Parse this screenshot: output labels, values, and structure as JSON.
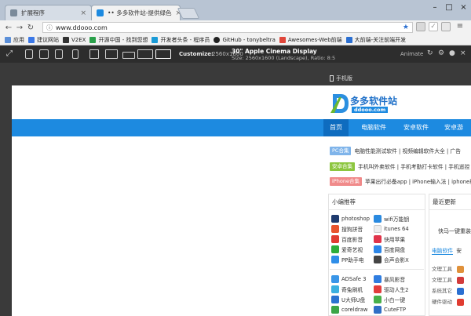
{
  "tabs": [
    {
      "title": "扩展程序",
      "active": false
    },
    {
      "title": "•• 多多软件站-提供绿色",
      "active": true
    }
  ],
  "address": {
    "url": "www.ddooo.com"
  },
  "bookmarks": [
    {
      "label": "应用",
      "color": "#5b8fd8"
    },
    {
      "label": "建议网站",
      "color": "#3b78e7"
    },
    {
      "label": "V2EX",
      "color": "#333333"
    },
    {
      "label": "开源中国 - 找到您想",
      "color": "#2aa04a"
    },
    {
      "label": "开发者头条 - 程序员",
      "color": "#1a9bd7"
    },
    {
      "label": "GitHub - tonybeltra",
      "color": "#222222"
    },
    {
      "label": "Awesomes-Web前端",
      "color": "#e0463a"
    },
    {
      "label": "大前端-关注前端开发",
      "color": "#2b6fd1"
    }
  ],
  "devtools": {
    "devices": [
      "10",
      "7",
      "5",
      "4",
      "lap",
      "13",
      "15",
      "27",
      "30"
    ],
    "customize_label": "Customize:",
    "customize_value": "2560x1600",
    "device_title": "30\" Apple Cinema Display",
    "device_info": "Size: 2560x1600 (Landscape), Ratio: 8:5",
    "animate_label": "Animate"
  },
  "page": {
    "mobile_label": "手机版",
    "logo_text": "多多软件站",
    "logo_sub": "ddooo.com",
    "nav": [
      "首页",
      "电脑软件",
      "安卓软件",
      "安卓游戏"
    ],
    "rows": [
      {
        "tag": "PC合集",
        "color": "#7fb4ea",
        "links": "电脑性能测试软件 | 视频编辑软件大全 | 广告"
      },
      {
        "tag": "安卓合集",
        "color": "#8cc63f",
        "links": "手机叫外卖软件 | 手机考勤打卡软件 | 手机遥控"
      },
      {
        "tag": "iPhone合集",
        "color": "#f08a8a",
        "links": "苹果出行必备app | iPhone输入法 | iphone相"
      }
    ],
    "rec_title": "小编推荐",
    "rec_items": [
      [
        "photoshop",
        "wifi万能钥"
      ],
      [
        "搜狗拼音",
        "itunes 64"
      ],
      [
        "百度影音",
        "快用苹果"
      ],
      [
        "爱奇艺视",
        "百度网盘"
      ],
      [
        "PP助手电",
        "会声会影X"
      ]
    ],
    "rec_items2": [
      [
        "ADSafe 3",
        "暴风影音"
      ],
      [
        "奇兔刷机",
        "驱动人生2"
      ],
      [
        "U大师U盘",
        "小白一键"
      ],
      [
        "coreldraw",
        "CuteFTP"
      ]
    ],
    "latest_title": "最近更新",
    "latest_sub": "快马一键重装",
    "latest_tabs": [
      "电脑软件",
      "安"
    ],
    "latest_cats": [
      "文理工具",
      "文理工具",
      "系统其它",
      "硬件驱动"
    ]
  }
}
